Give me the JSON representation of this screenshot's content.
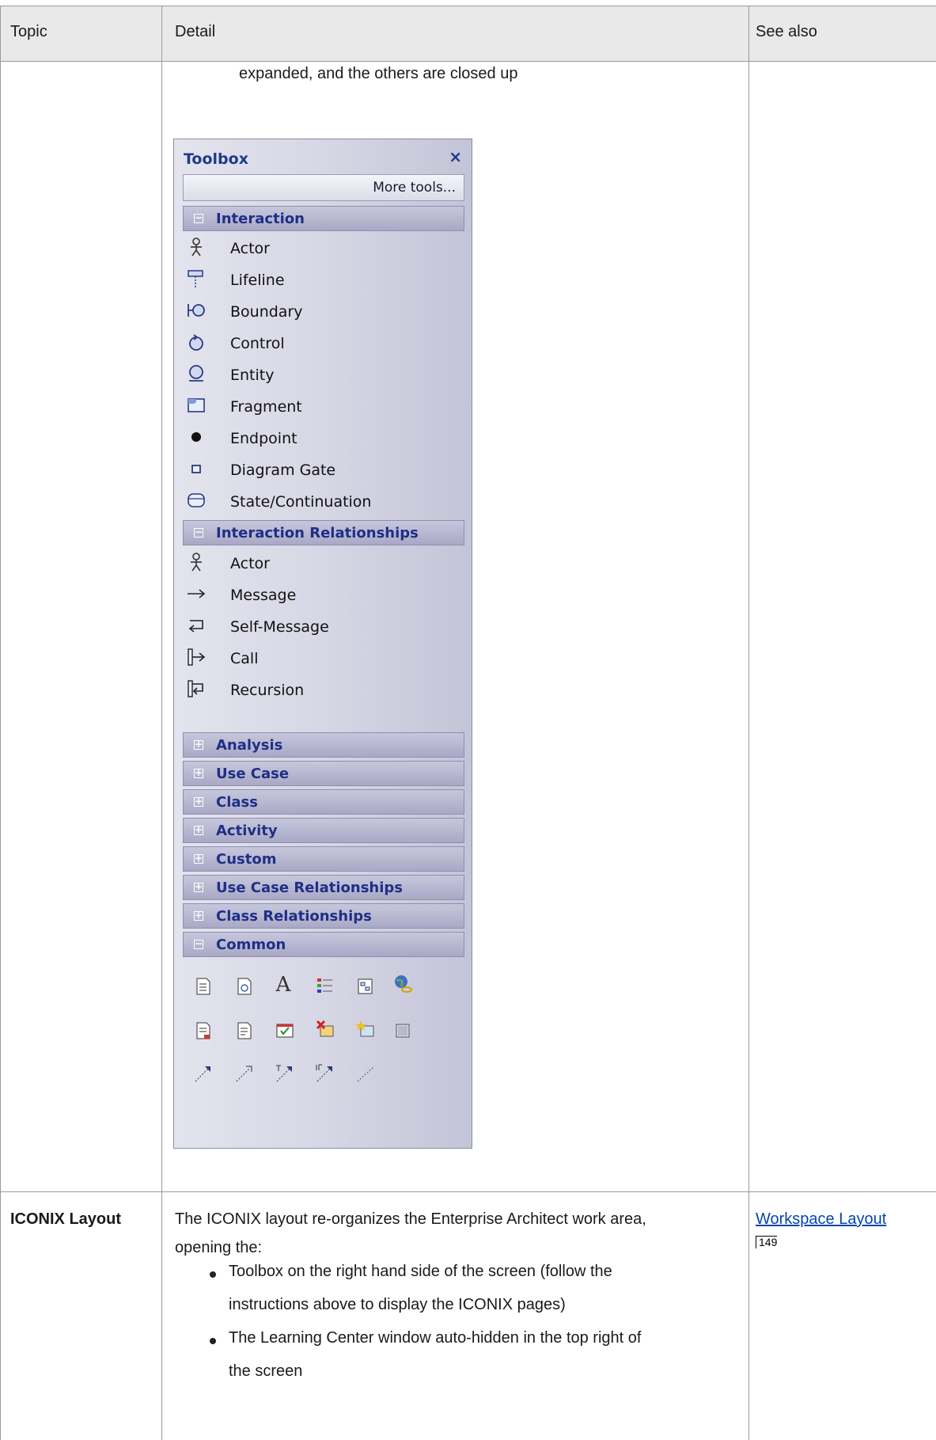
{
  "table": {
    "headers": {
      "topic": "Topic",
      "detail": "Detail",
      "see_also": "See also"
    },
    "row1": {
      "detail_text": "expanded, and the others are closed up"
    },
    "row2": {
      "topic": "ICONIX Layout",
      "detail_line1": "The ICONIX layout re-organizes the Enterprise Architect work area,",
      "detail_line2": "opening the:",
      "bullets": [
        {
          "line1": "Toolbox on the right hand side of the screen (follow the",
          "line2": "instructions above to display the ICONIX pages)"
        },
        {
          "line1": "The Learning Center window auto-hidden in the top right of",
          "line2": "the screen"
        }
      ],
      "see_also_link": "Workspace Layout",
      "see_also_page": "149"
    }
  },
  "toolbox": {
    "title": "Toolbox",
    "close_glyph": "×",
    "more_tools": "More tools...",
    "groups": [
      {
        "label": "Interaction",
        "state": "−",
        "items": [
          "Actor",
          "Lifeline",
          "Boundary",
          "Control",
          "Entity",
          "Fragment",
          "Endpoint",
          "Diagram Gate",
          "State/Continuation"
        ]
      },
      {
        "label": "Interaction Relationships",
        "state": "−",
        "items": [
          "Actor",
          "Message",
          "Self-Message",
          "Call",
          "Recursion"
        ]
      },
      {
        "label": "Analysis",
        "state": "+"
      },
      {
        "label": "Use Case",
        "state": "+"
      },
      {
        "label": "Class",
        "state": "+"
      },
      {
        "label": "Activity",
        "state": "+"
      },
      {
        "label": "Custom",
        "state": "+"
      },
      {
        "label": "Use Case Relationships",
        "state": "+"
      },
      {
        "label": "Class Relationships",
        "state": "+"
      },
      {
        "label": "Common",
        "state": "−"
      }
    ],
    "common_icons_glyph": "A"
  },
  "colors": {
    "header_bg": "#e9e9e9",
    "toolbox_title": "#1f3a8a",
    "group_bg": "#b4b4cf",
    "link": "#0645ad"
  }
}
